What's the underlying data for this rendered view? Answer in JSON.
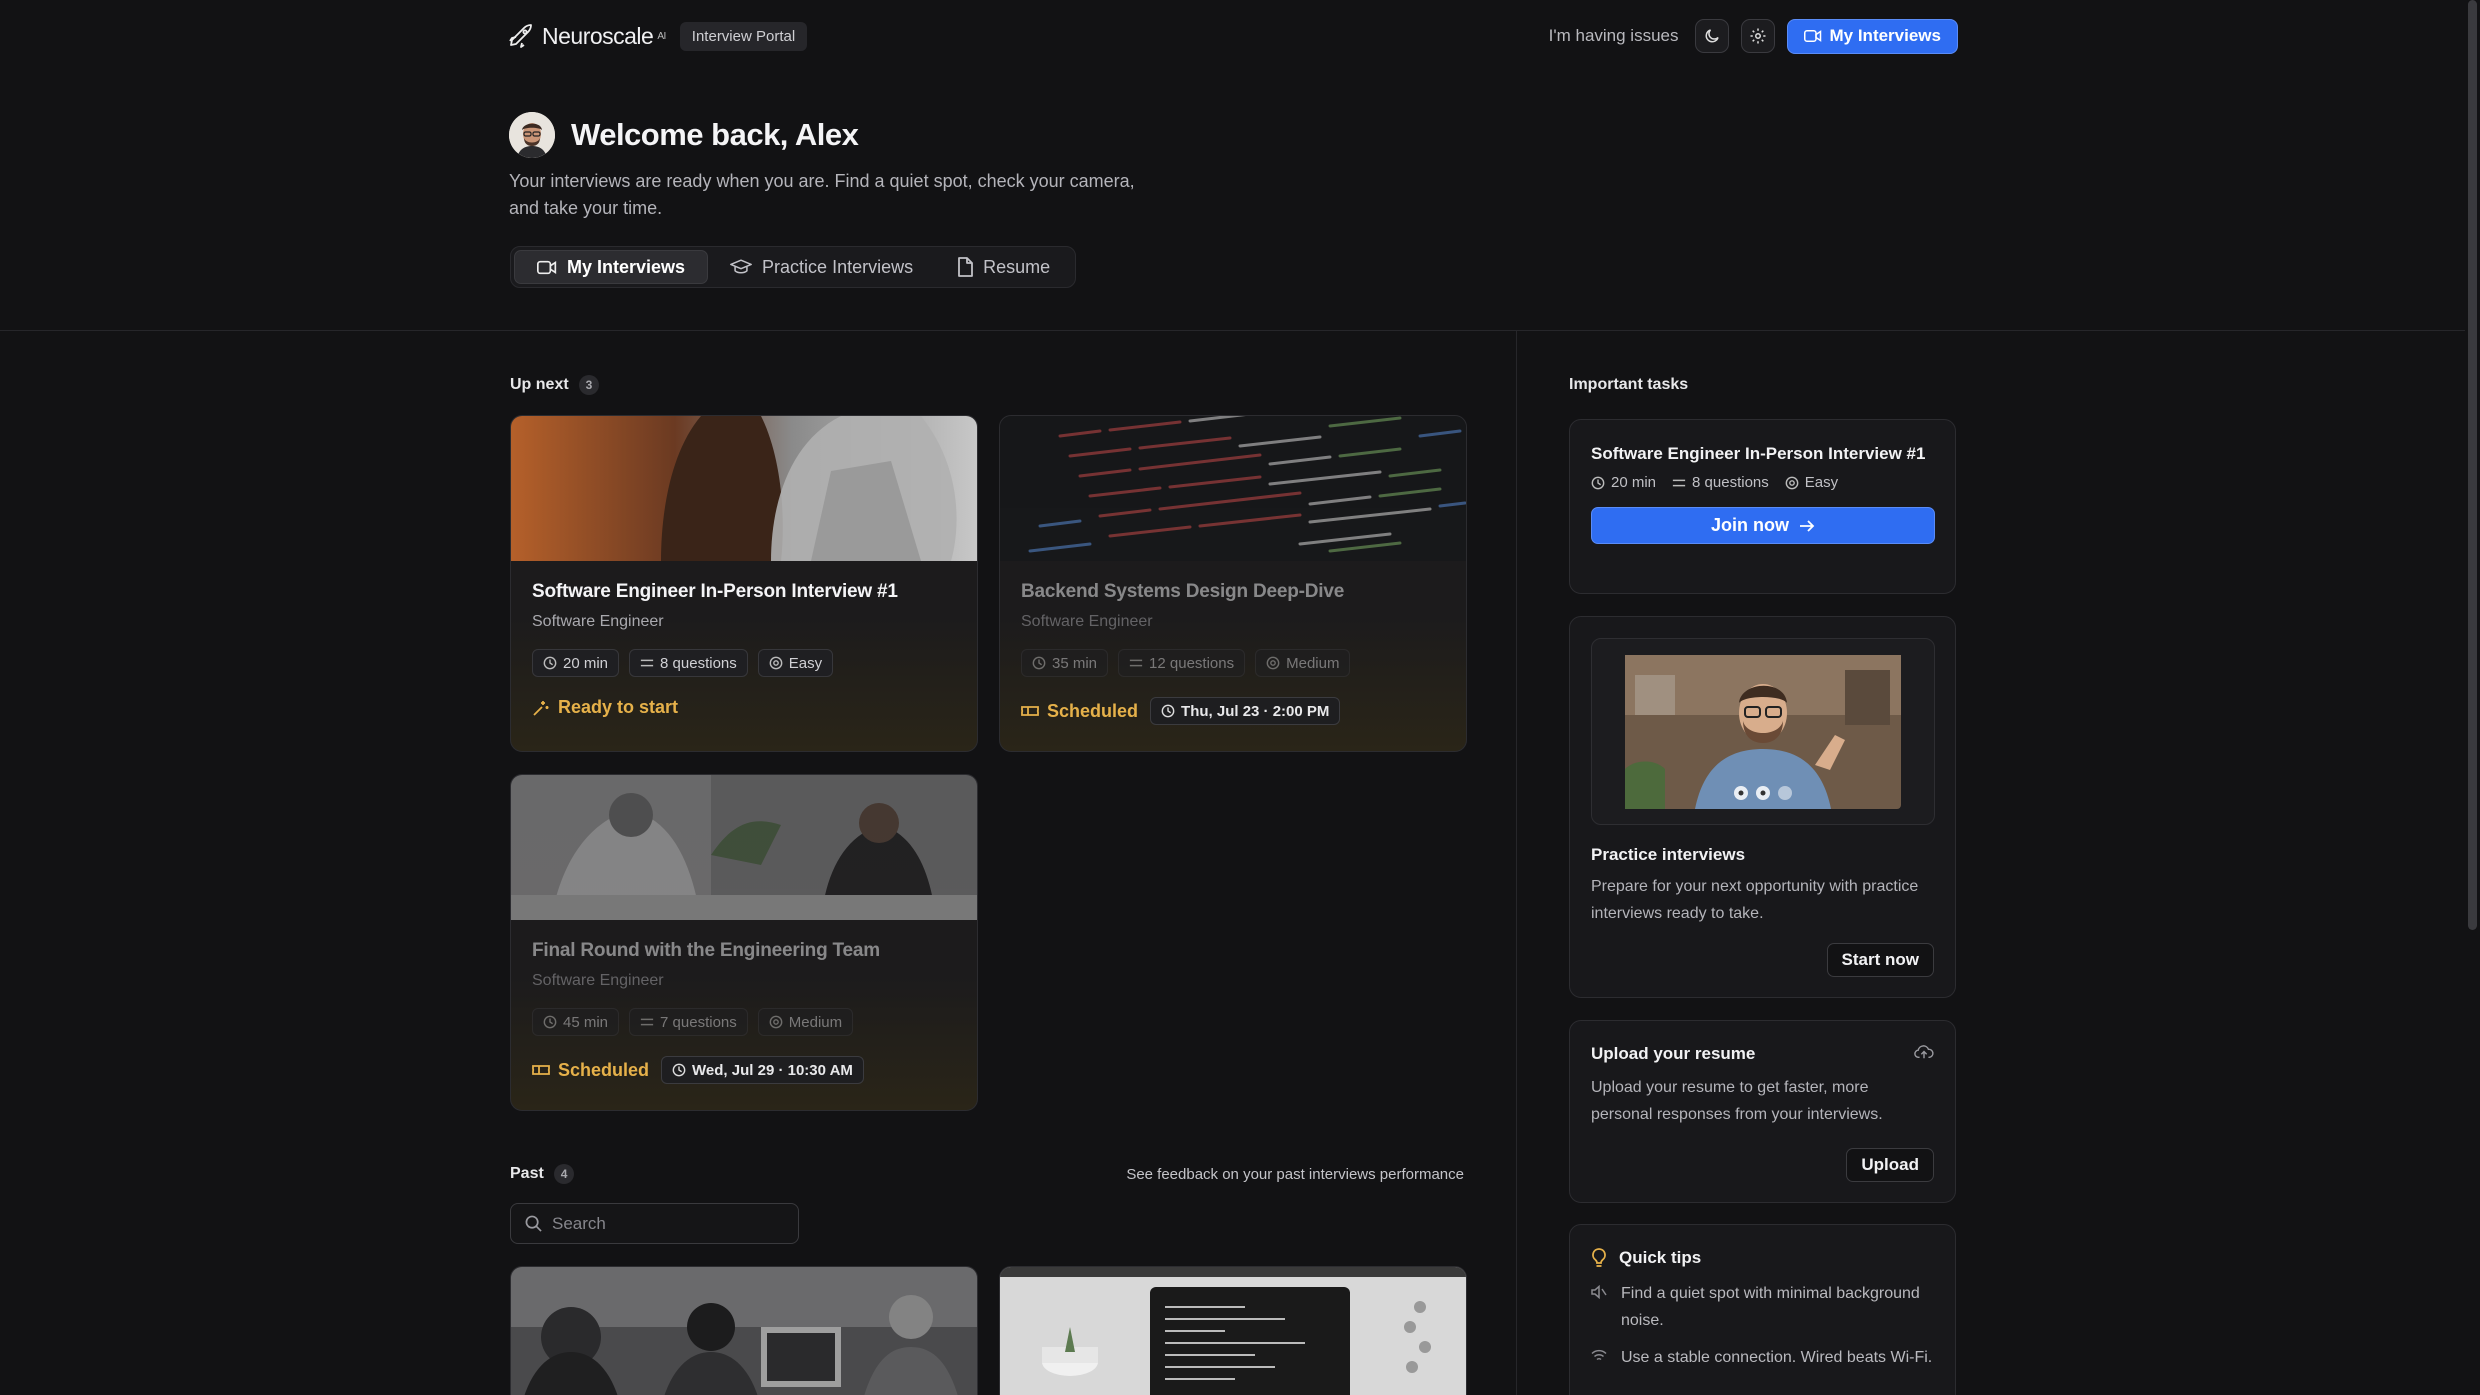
{
  "header": {
    "brand": "Neuroscale",
    "brand_suffix": "AI",
    "portal_label": "Interview Portal",
    "issues_link": "I'm having issues",
    "my_interviews_button": "My Interviews"
  },
  "welcome": {
    "title": "Welcome back, Alex",
    "subtitle": "Your interviews are ready when you are. Find a quiet spot, check your camera, and take your time."
  },
  "tabs": [
    {
      "label": "My Interviews",
      "active": true,
      "icon": "video-icon"
    },
    {
      "label": "Practice Interviews",
      "active": false,
      "icon": "graduation-cap-icon"
    },
    {
      "label": "Resume",
      "active": false,
      "icon": "file-icon"
    }
  ],
  "up_next": {
    "label": "Up next",
    "count": "3",
    "cards": [
      {
        "title": "Software Engineer In-Person Interview #1",
        "role": "Software Engineer",
        "duration": "20 min",
        "questions": "8 questions",
        "difficulty": "Easy",
        "status": "Ready to start",
        "time": ""
      },
      {
        "title": "Backend Systems Design Deep-Dive",
        "role": "Software Engineer",
        "duration": "35 min",
        "questions": "12 questions",
        "difficulty": "Medium",
        "status": "Scheduled",
        "time": "Thu, Jul 23 · 2:00 PM"
      },
      {
        "title": "Final Round with the Engineering Team",
        "role": "Software Engineer",
        "duration": "45 min",
        "questions": "7 questions",
        "difficulty": "Medium",
        "status": "Scheduled",
        "time": "Wed, Jul 29 · 10:30 AM"
      }
    ]
  },
  "past": {
    "label": "Past",
    "count": "4",
    "feedback_link": "See feedback on your past interviews performance",
    "search_placeholder": "Search"
  },
  "sidebar": {
    "title": "Important tasks",
    "task": {
      "title": "Software Engineer In-Person Interview #1",
      "duration": "20 min",
      "questions": "8 questions",
      "difficulty": "Easy",
      "button": "Join now"
    },
    "practice": {
      "title": "Practice interviews",
      "text": "Prepare for your next opportunity with practice interviews ready to take.",
      "button": "Start now"
    },
    "resume": {
      "title": "Upload your resume",
      "text": "Upload your resume to get faster, more personal responses from your interviews.",
      "button": "Upload"
    },
    "tips": {
      "title": "Quick tips",
      "items": [
        "Find a quiet spot with minimal background noise.",
        "Use a stable connection. Wired beats Wi-Fi."
      ]
    }
  },
  "colors": {
    "accent": "#2f6df2",
    "status": "#e6b14a",
    "background": "#121214"
  }
}
